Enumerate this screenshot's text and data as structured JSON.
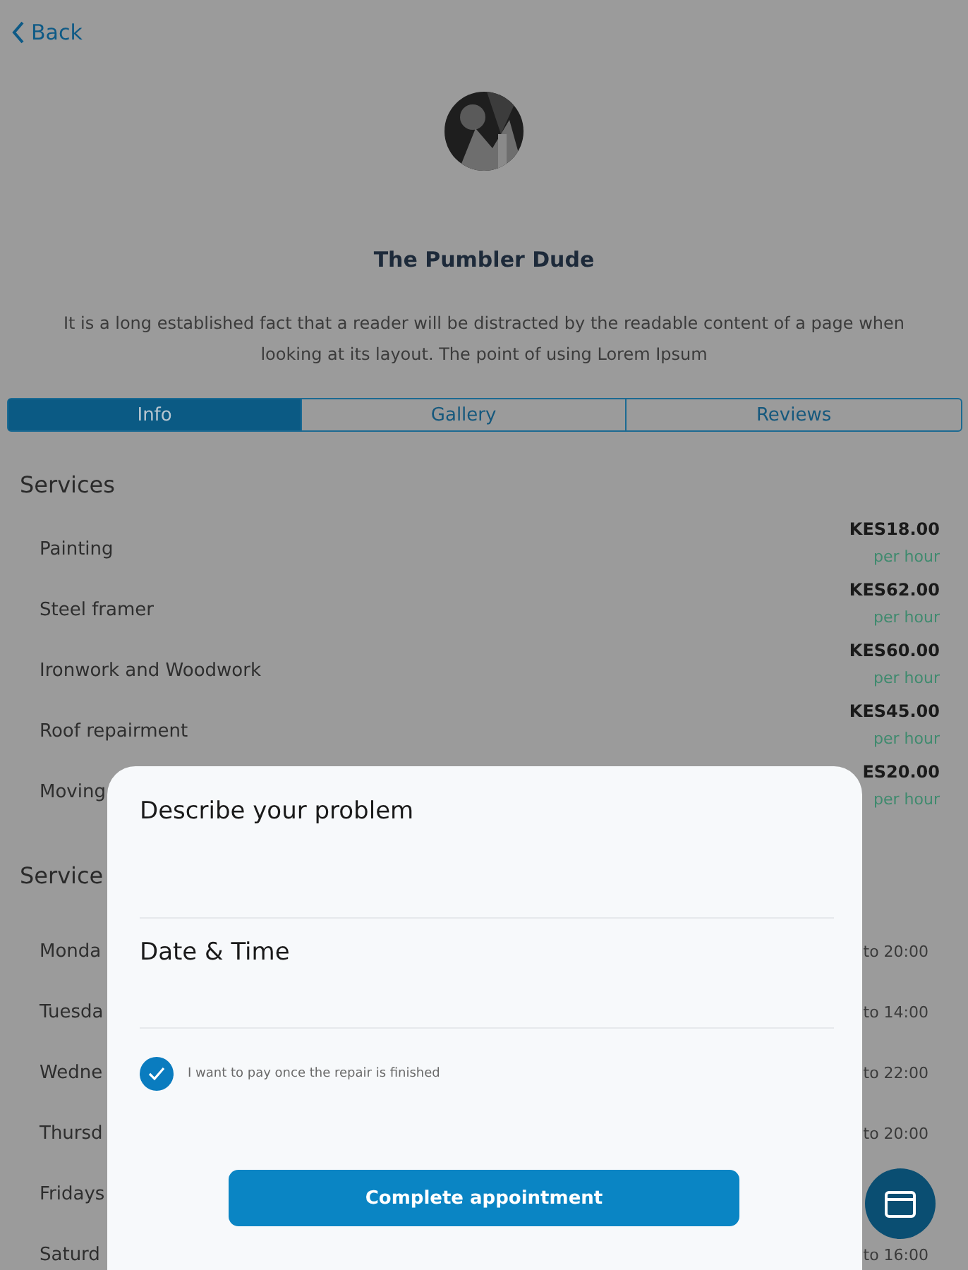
{
  "header": {
    "back_label": "Back"
  },
  "profile": {
    "name": "The Pumbler Dude",
    "description": "It is a long established fact that a reader will be distracted by the readable content of a page when looking at its layout. The point of using Lorem Ipsum"
  },
  "tabs": [
    {
      "label": "Info",
      "selected": true
    },
    {
      "label": "Gallery",
      "selected": false
    },
    {
      "label": "Reviews",
      "selected": false
    }
  ],
  "services": {
    "title": "Services",
    "items": [
      {
        "name": "Painting",
        "price": "KES18.00",
        "unit": "per hour"
      },
      {
        "name": "Steel framer",
        "price": "KES62.00",
        "unit": "per hour"
      },
      {
        "name": "Ironwork and Woodwork",
        "price": "KES60.00",
        "unit": "per hour"
      },
      {
        "name": "Roof repairment",
        "price": "KES45.00",
        "unit": "per hour"
      },
      {
        "name": "Moving",
        "price": "ES20.00",
        "unit": "per hour"
      }
    ]
  },
  "hours": {
    "title": "Service",
    "items": [
      {
        "day": "Monda",
        "time": "to 20:00"
      },
      {
        "day": "Tuesda",
        "time": "to 14:00"
      },
      {
        "day": "Wedne",
        "time": "to 22:00"
      },
      {
        "day": "Thursd",
        "time": "to 20:00"
      },
      {
        "day": "Fridays"
      },
      {
        "day": "Saturd",
        "time": "to 16:00"
      }
    ]
  },
  "modal": {
    "fields": [
      {
        "label": "Describe your problem"
      },
      {
        "label": "Date & Time"
      }
    ],
    "checkbox": {
      "label": "I want to pay once the repair is finished",
      "checked": true
    },
    "button": "Complete appointment"
  }
}
